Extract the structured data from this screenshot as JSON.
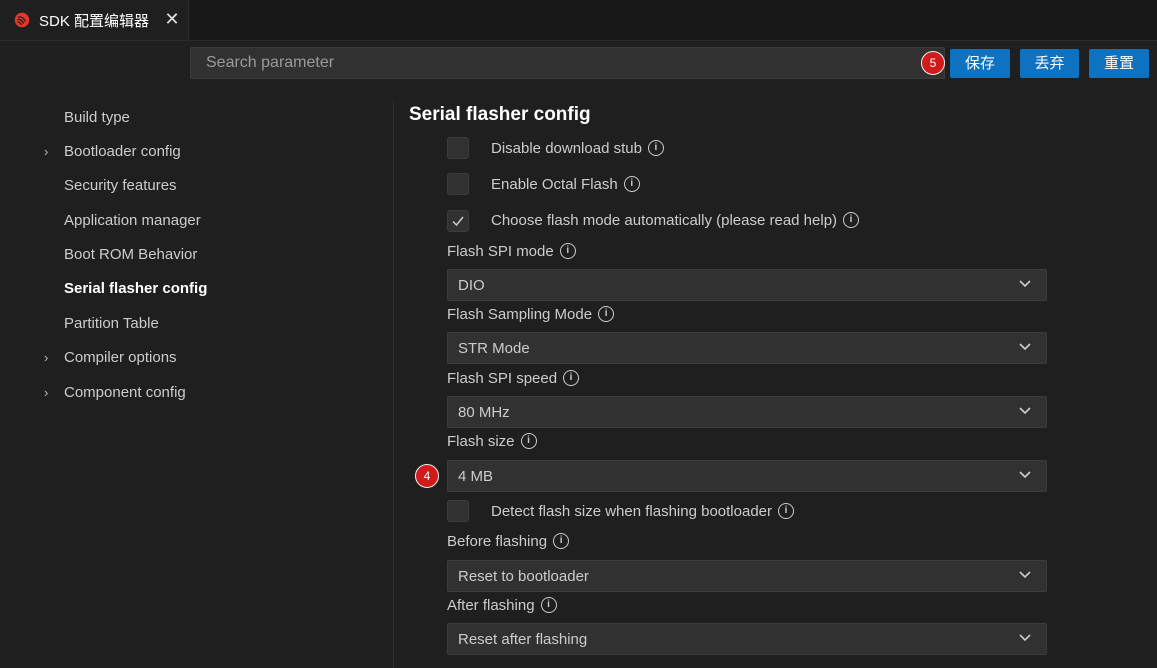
{
  "tab": {
    "title": "SDK 配置编辑器",
    "close_glyph": "✕",
    "logo_icon": "espressif-logo-icon",
    "logo_color": "#e8362a"
  },
  "search": {
    "placeholder": "Search parameter"
  },
  "toolbar": {
    "save_label": "保存",
    "discard_label": "丢弃",
    "reset_label": "重置",
    "accent_color": "#0e72c0"
  },
  "badges": {
    "toolbar_step": "5",
    "flash_size_step": "4",
    "badge_color": "#d11a1a"
  },
  "sidebar": {
    "items": [
      {
        "label": "Build type",
        "expandable": false,
        "active": false
      },
      {
        "label": "Bootloader config",
        "expandable": true,
        "active": false
      },
      {
        "label": "Security features",
        "expandable": false,
        "active": false
      },
      {
        "label": "Application manager",
        "expandable": false,
        "active": false
      },
      {
        "label": "Boot ROM Behavior",
        "expandable": false,
        "active": false
      },
      {
        "label": "Serial flasher config",
        "expandable": false,
        "active": true
      },
      {
        "label": "Partition Table",
        "expandable": false,
        "active": false
      },
      {
        "label": "Compiler options",
        "expandable": true,
        "active": false
      },
      {
        "label": "Component config",
        "expandable": true,
        "active": false
      }
    ]
  },
  "main": {
    "section_title": "Serial flasher config",
    "disable_download_stub": {
      "label": "Disable download stub",
      "checked": false
    },
    "enable_octal_flash": {
      "label": "Enable Octal Flash",
      "checked": false
    },
    "choose_flash_mode_auto": {
      "label": "Choose flash mode automatically (please read help)",
      "checked": true
    },
    "flash_spi_mode": {
      "label": "Flash SPI mode",
      "value": "DIO"
    },
    "flash_sampling_mode": {
      "label": "Flash Sampling Mode",
      "value": "STR Mode"
    },
    "flash_spi_speed": {
      "label": "Flash SPI speed",
      "value": "80 MHz"
    },
    "flash_size": {
      "label": "Flash size",
      "value": "4 MB"
    },
    "detect_flash_size": {
      "label": "Detect flash size when flashing bootloader",
      "checked": false
    },
    "before_flashing": {
      "label": "Before flashing",
      "value": "Reset to bootloader"
    },
    "after_flashing": {
      "label": "After flashing",
      "value": "Reset after flashing"
    }
  }
}
